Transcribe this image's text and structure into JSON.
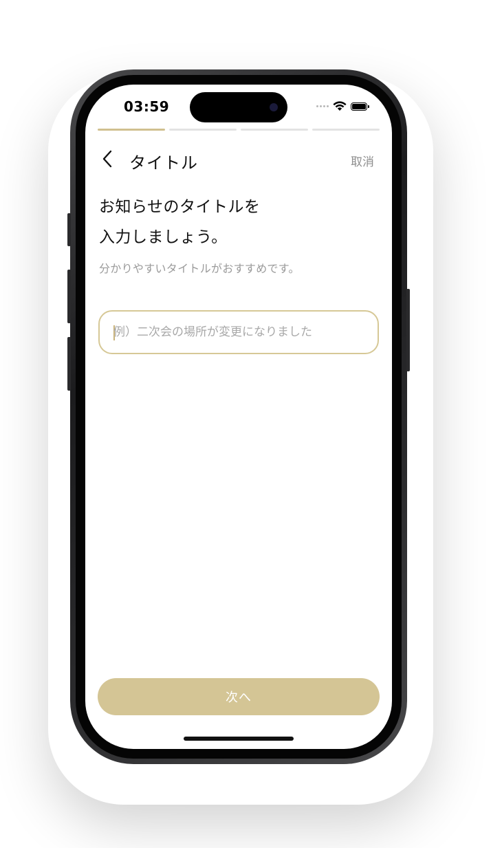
{
  "status_bar": {
    "time": "03:59"
  },
  "progress": {
    "steps_total": 4,
    "current_step": 1
  },
  "nav": {
    "title": "タイトル",
    "cancel_label": "取消"
  },
  "content": {
    "headline_line1": "お知らせのタイトルを",
    "headline_line2": "入力しましょう。",
    "subtext": "分かりやすいタイトルがおすすめです。"
  },
  "title_input": {
    "value": "",
    "placeholder": "例）二次会の場所が変更になりました"
  },
  "footer": {
    "next_label": "次へ"
  },
  "colors": {
    "accent": "#d0c08f",
    "button": "#d4c595",
    "input_border": "#d6c896",
    "muted_text": "#9a9a9a"
  }
}
